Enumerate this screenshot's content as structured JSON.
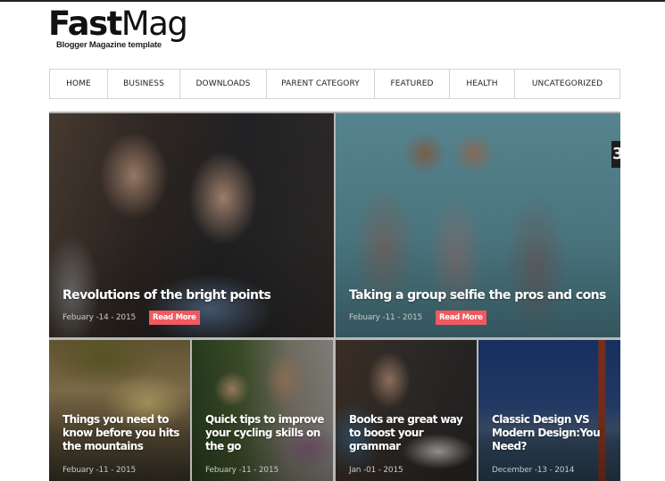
{
  "header": {
    "logo_bold": "Fast",
    "logo_light": "Mag",
    "tagline": "Blogger Magazine template"
  },
  "nav": {
    "items": [
      {
        "label": "HOME"
      },
      {
        "label": "BUSINESS"
      },
      {
        "label": "DOWNLOADS"
      },
      {
        "label": "PARENT CATEGORY"
      },
      {
        "label": "FEATURED"
      },
      {
        "label": "HEALTH"
      },
      {
        "label": "UNCATEGORIZED"
      }
    ]
  },
  "featured": [
    {
      "title": "Revolutions of the bright points",
      "date": "Febuary -14 - 2015",
      "read_more": "Read More"
    },
    {
      "title": "Taking a group selfie the pros and cons",
      "date": "Febuary -11 - 2015",
      "read_more": "Read More",
      "badge": "3"
    }
  ],
  "posts": [
    {
      "title": "Things you need to know before you hits the mountains",
      "date": "Febuary -11 - 2015"
    },
    {
      "title": "Quick tips to improve your cycling skills on the go",
      "date": "Febuary -11 - 2015"
    },
    {
      "title": "Books are great way to boost your grammar",
      "date": "Jan -01 - 2015"
    },
    {
      "title": "Classic Design VS Modern Design:You Need?",
      "date": "December -13 - 2014"
    }
  ],
  "colors": {
    "accent": "#f05a5f",
    "nav_border": "#d4d4d4",
    "text_dark": "#222222"
  }
}
